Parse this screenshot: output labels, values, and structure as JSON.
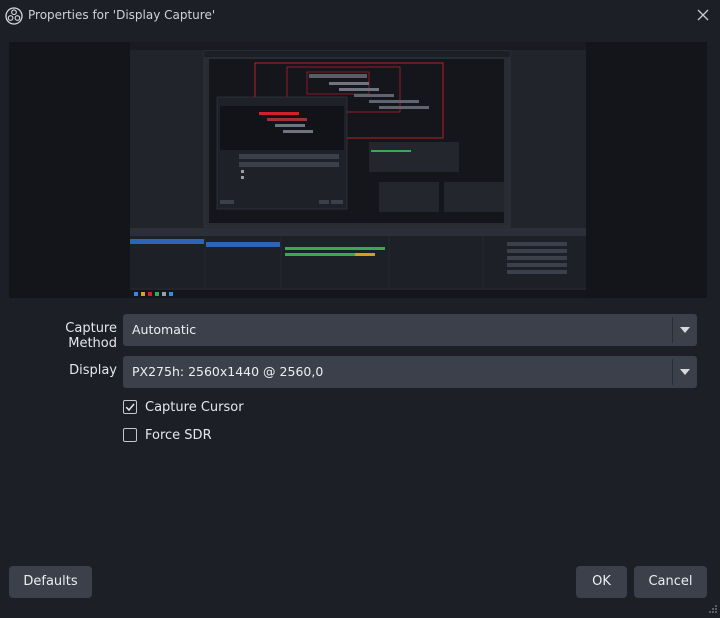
{
  "window": {
    "title": "Properties for 'Display Capture'"
  },
  "form": {
    "capture_method_label": "Capture Method",
    "capture_method_value": "Automatic",
    "display_label": "Display",
    "display_value": "PX275h: 2560x1440 @ 2560,0",
    "capture_cursor_label": "Capture Cursor",
    "capture_cursor_checked": true,
    "force_sdr_label": "Force SDR",
    "force_sdr_checked": false
  },
  "buttons": {
    "defaults": "Defaults",
    "ok": "OK",
    "cancel": "Cancel"
  },
  "colors": {
    "background": "#1d1f26",
    "control": "#3c404b",
    "preview_background": "#14151a",
    "selection_red": "#d0202a"
  },
  "icons": {
    "app": "obs-logo-icon",
    "close": "close-icon",
    "dropdown": "chevron-down-icon",
    "check": "checkmark-icon"
  }
}
